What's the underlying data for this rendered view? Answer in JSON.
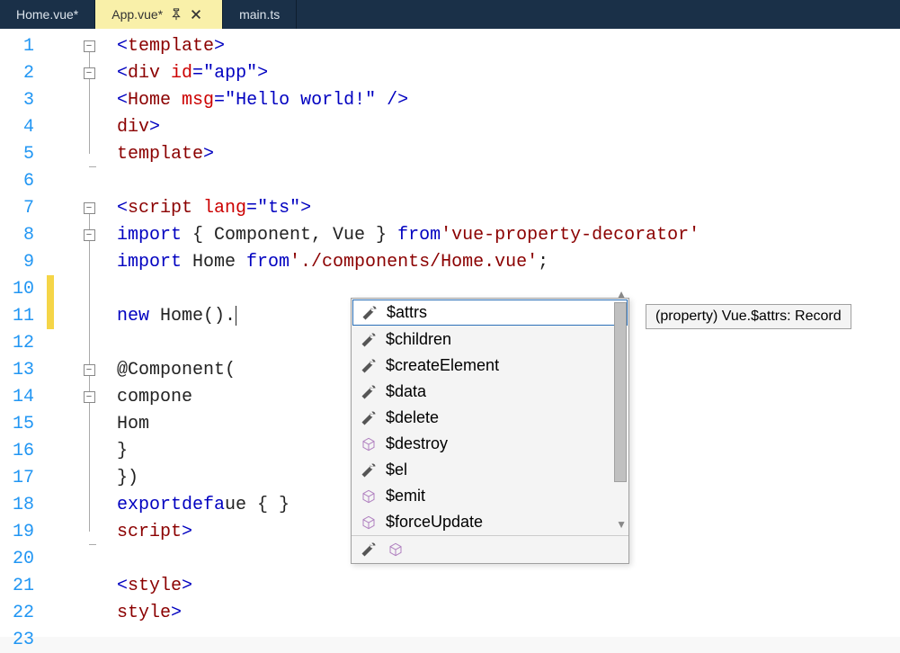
{
  "tabs": [
    {
      "label": "Home.vue*",
      "active": false
    },
    {
      "label": "App.vue*",
      "active": true
    },
    {
      "label": "main.ts",
      "active": false
    }
  ],
  "line_numbers": [
    "1",
    "2",
    "3",
    "4",
    "5",
    "6",
    "7",
    "8",
    "9",
    "10",
    "11",
    "12",
    "13",
    "14",
    "15",
    "16",
    "17",
    "18",
    "19",
    "20",
    "21",
    "22",
    "23"
  ],
  "code": {
    "l1": {
      "p1": "<",
      "tag": "template",
      "p2": ">"
    },
    "l2": {
      "p1": "<",
      "tag": "div ",
      "attr": "id",
      "eq": "=",
      "q1": "\"",
      "val": "app",
      "q2": "\"",
      "p2": ">"
    },
    "l3": {
      "p1": "<",
      "tag": "Home ",
      "attr": "msg",
      "eq": "=",
      "q1": "\"",
      "val": "Hello world!",
      "q2": "\"",
      "close": " />"
    },
    "l4": {
      "p1": "</",
      "tag": "div",
      "p2": ">"
    },
    "l5": {
      "p1": "</",
      "tag": "template",
      "p2": ">"
    },
    "l7": {
      "p1": "<",
      "tag": "script ",
      "attr": "lang",
      "eq": "=",
      "q1": "\"",
      "val": "ts",
      "q2": "\"",
      "p2": ">"
    },
    "l8": {
      "kw1": "import",
      "txt1": " { Component, Vue } ",
      "kw2": "from",
      "sp": " ",
      "str": "'vue-property-decorator'"
    },
    "l9": {
      "kw1": "import",
      "txt1": " Home ",
      "kw2": "from",
      "sp": " ",
      "str": "'./components/Home.vue'",
      "semi": ";"
    },
    "l11": {
      "kw": "new",
      "txt": " Home()."
    },
    "l13": {
      "txt": "@Component("
    },
    "l14": {
      "txt": "compone"
    },
    "l15": {
      "txt": "Hom"
    },
    "l16": {
      "txt": "}"
    },
    "l17": {
      "txt": "})"
    },
    "l18": {
      "kw1": "export",
      "sp1": " ",
      "kw2": "defa",
      "tail": "ue { }"
    },
    "l19": {
      "p1": "</",
      "tag": "script",
      "p2": ">"
    },
    "l21": {
      "p1": "<",
      "tag": "style",
      "p2": ">"
    },
    "l22": {
      "p1": "</",
      "tag": "style",
      "p2": ">"
    }
  },
  "intellisense": {
    "items": [
      {
        "icon": "wrench",
        "label": "$attrs",
        "selected": true
      },
      {
        "icon": "wrench",
        "label": "$children"
      },
      {
        "icon": "wrench",
        "label": "$createElement"
      },
      {
        "icon": "wrench",
        "label": "$data"
      },
      {
        "icon": "wrench",
        "label": "$delete"
      },
      {
        "icon": "cube",
        "label": "$destroy"
      },
      {
        "icon": "wrench",
        "label": "$el"
      },
      {
        "icon": "cube",
        "label": "$emit"
      },
      {
        "icon": "cube",
        "label": "$forceUpdate"
      }
    ]
  },
  "tooltip": "(property) Vue.$attrs: Record"
}
